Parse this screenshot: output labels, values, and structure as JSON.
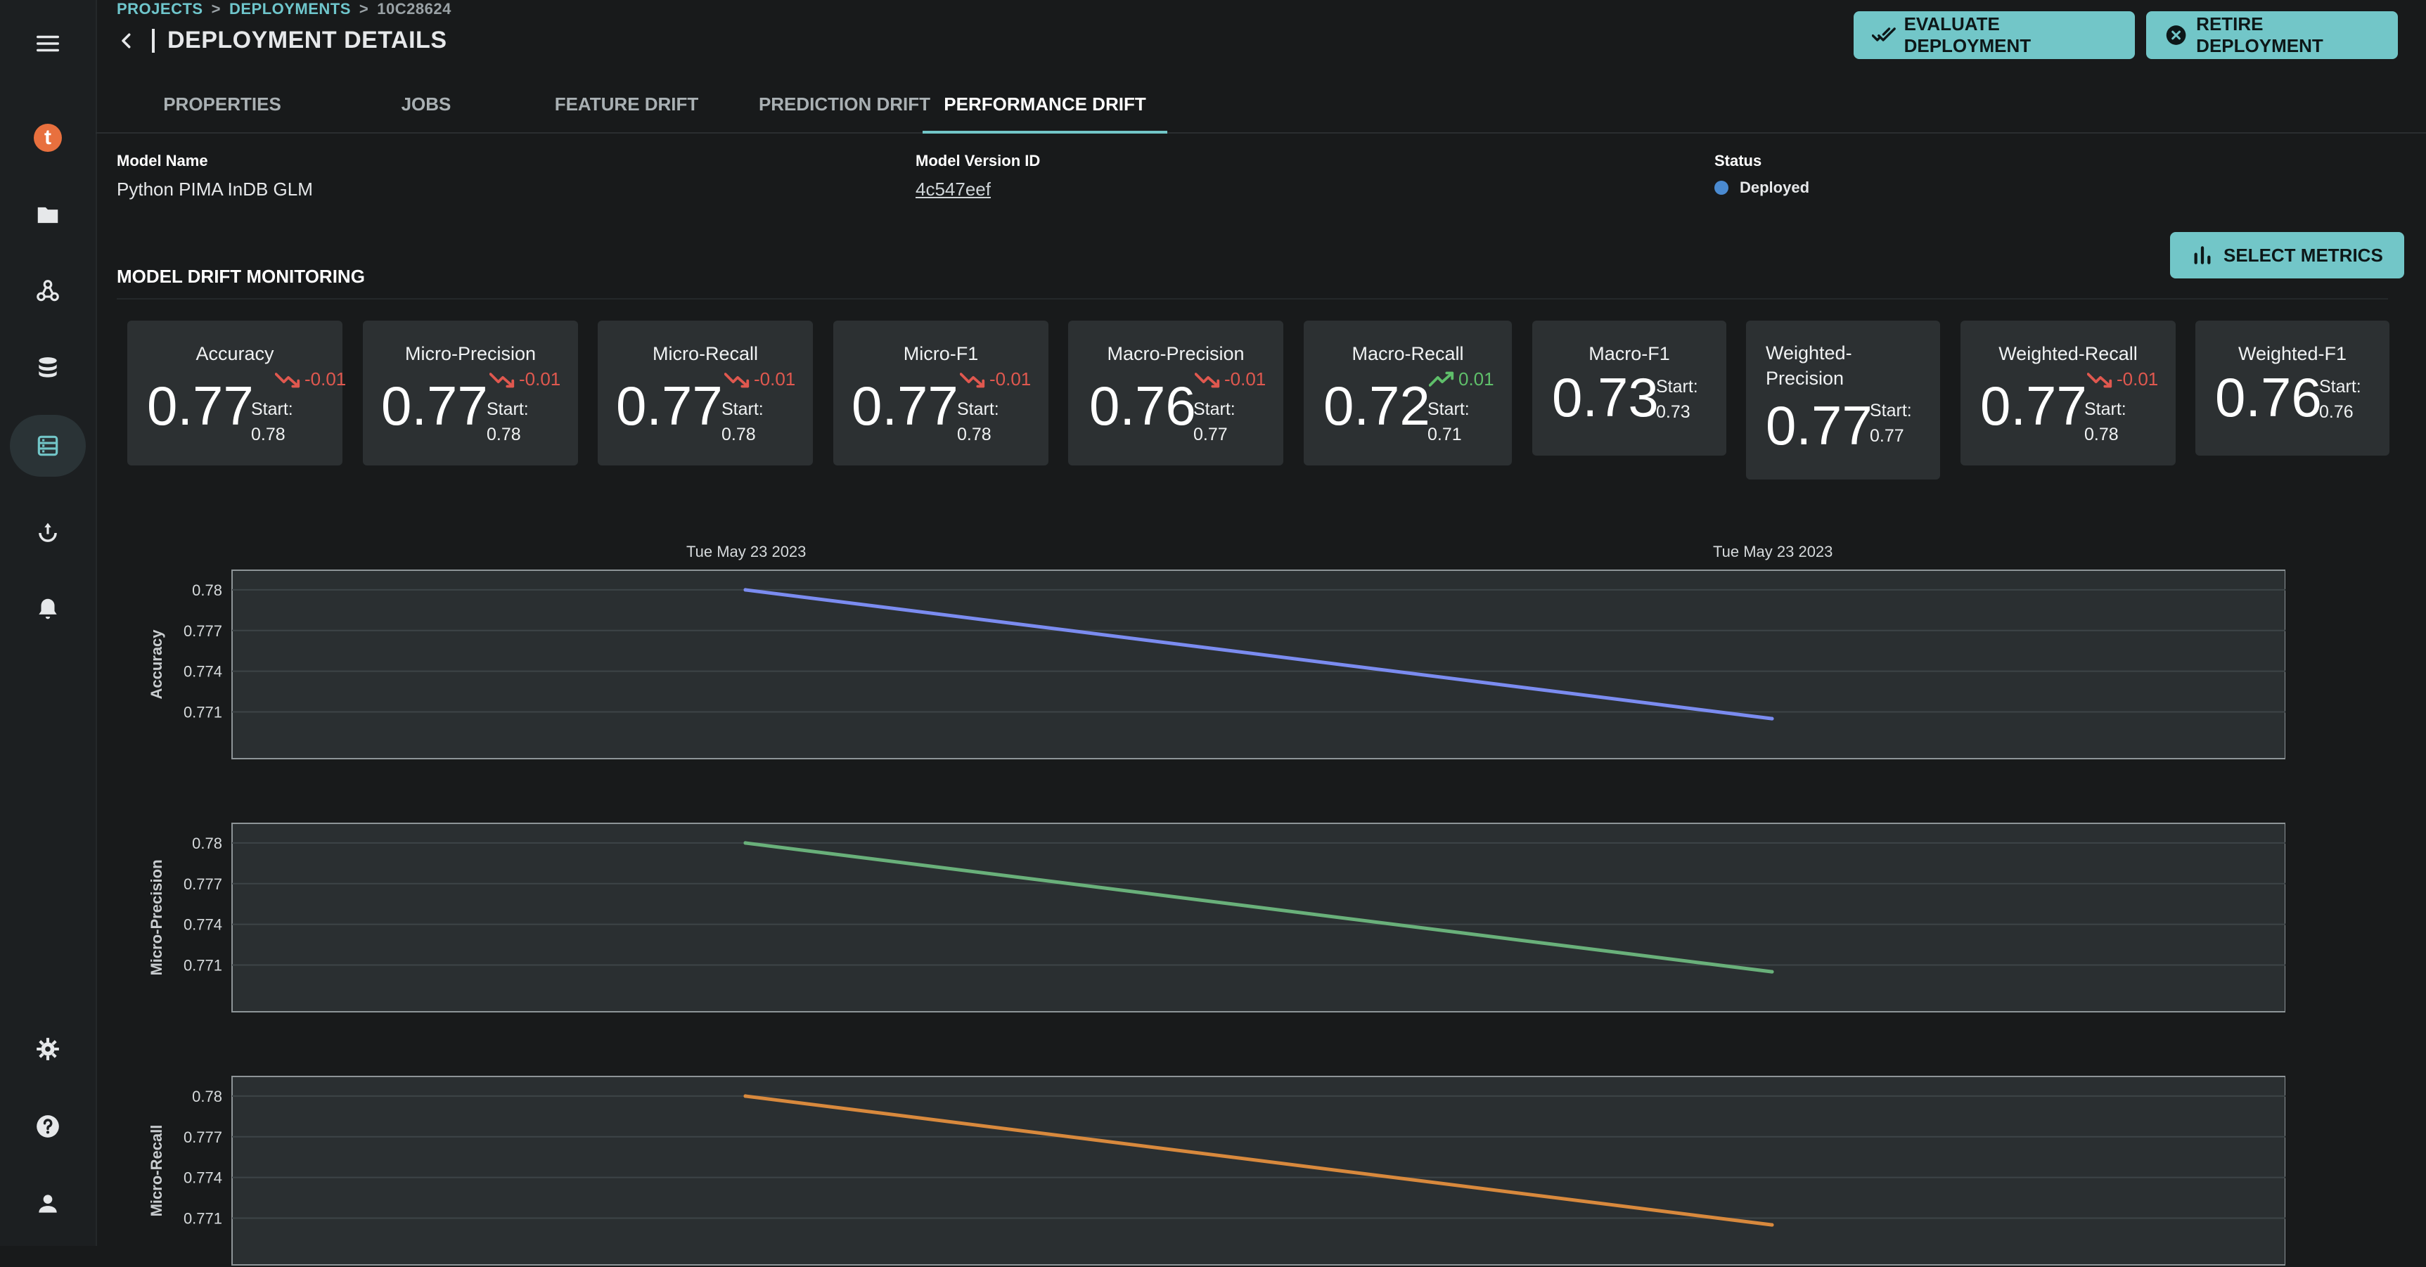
{
  "breadcrumb": {
    "projects": "PROJECTS",
    "deployments": "DEPLOYMENTS",
    "current": "10C28624",
    "sep": ">"
  },
  "header": {
    "title": "DEPLOYMENT DETAILS",
    "evaluate_label": "EVALUATE DEPLOYMENT",
    "retire_label": "RETIRE DEPLOYMENT"
  },
  "tabs": [
    {
      "label": "PROPERTIES"
    },
    {
      "label": "JOBS"
    },
    {
      "label": "FEATURE DRIFT"
    },
    {
      "label": "PREDICTION DRIFT"
    },
    {
      "label": "PERFORMANCE DRIFT",
      "active": true
    }
  ],
  "properties": {
    "model_name_label": "Model Name",
    "model_name": "Python PIMA InDB GLM",
    "version_label": "Model Version ID",
    "version_id": "4c547eef",
    "status_label": "Status",
    "status": "Deployed"
  },
  "monitoring": {
    "title": "MODEL DRIFT MONITORING",
    "select_metrics_label": "SELECT METRICS",
    "start_label": "Start:",
    "metrics": [
      {
        "name": "Accuracy",
        "value": "0.77",
        "delta": "-0.01",
        "trend": "down",
        "start": "0.78"
      },
      {
        "name": "Micro-Precision",
        "value": "0.77",
        "delta": "-0.01",
        "trend": "down",
        "start": "0.78"
      },
      {
        "name": "Micro-Recall",
        "value": "0.77",
        "delta": "-0.01",
        "trend": "down",
        "start": "0.78"
      },
      {
        "name": "Micro-F1",
        "value": "0.77",
        "delta": "-0.01",
        "trend": "down",
        "start": "0.78"
      },
      {
        "name": "Macro-Precision",
        "value": "0.76",
        "delta": "-0.01",
        "trend": "down",
        "start": "0.77"
      },
      {
        "name": "Macro-Recall",
        "value": "0.72",
        "delta": "0.01",
        "trend": "up",
        "start": "0.71"
      },
      {
        "name": "Macro-F1",
        "value": "0.73",
        "delta": "",
        "trend": "none",
        "start": "0.73"
      },
      {
        "name": "Weighted-Precision",
        "value": "0.77",
        "delta": "",
        "trend": "none",
        "start": "0.77"
      },
      {
        "name": "Weighted-Recall",
        "value": "0.77",
        "delta": "-0.01",
        "trend": "down",
        "start": "0.78"
      },
      {
        "name": "Weighted-F1",
        "value": "0.76",
        "delta": "",
        "trend": "none",
        "start": "0.76"
      }
    ]
  },
  "colors": {
    "accent": "#72c6c8",
    "down": "#e0584f",
    "up": "#5fbf6a",
    "series_accuracy": "#7b8cf0",
    "series_micro_precision": "#69b07a",
    "series_micro_recall": "#d8893d"
  },
  "icons": {
    "sidebar": [
      "menu-icon",
      "logo-icon",
      "folder-icon",
      "webhook-icon",
      "database-icon",
      "deployments-icon",
      "monitoring-icon",
      "alerts-icon",
      "settings-icon",
      "help-icon",
      "user-icon"
    ]
  },
  "chart_data": [
    {
      "type": "line",
      "ylabel": "Accuracy",
      "x": [
        "Tue May 23 2023",
        "Tue May 23 2023"
      ],
      "yticks": [
        "0.78",
        "0.777",
        "0.774",
        "0.771"
      ],
      "ylim": [
        0.7675,
        0.7815
      ],
      "series": [
        {
          "values": [
            0.78,
            0.7705
          ]
        }
      ]
    },
    {
      "type": "line",
      "ylabel": "Micro-Precision",
      "x": [
        "Tue May 23 2023",
        "Tue May 23 2023"
      ],
      "yticks": [
        "0.78",
        "0.777",
        "0.774",
        "0.771"
      ],
      "ylim": [
        0.7675,
        0.7815
      ],
      "series": [
        {
          "values": [
            0.78,
            0.7705
          ]
        }
      ]
    },
    {
      "type": "line",
      "ylabel": "Micro-Recall",
      "x": [
        "Tue May 23 2023",
        "Tue May 23 2023"
      ],
      "yticks": [
        "0.78",
        "0.777",
        "0.774",
        "0.771"
      ],
      "ylim": [
        0.7675,
        0.7815
      ],
      "series": [
        {
          "values": [
            0.78,
            0.7705
          ]
        }
      ]
    }
  ]
}
